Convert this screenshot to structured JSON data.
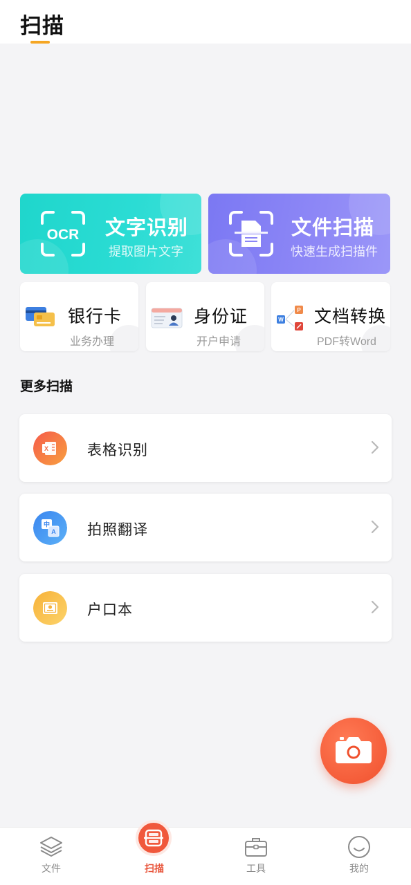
{
  "header": {
    "title": "扫描"
  },
  "big_cards": {
    "ocr": {
      "icon_text": "OCR",
      "title": "文字识别",
      "subtitle": "提取图片文字",
      "color": "#22d8cf"
    },
    "scan": {
      "title": "文件扫描",
      "subtitle": "快速生成扫描件",
      "color": "#8b86f6"
    }
  },
  "small_cards": [
    {
      "title": "银行卡",
      "subtitle": "业务办理",
      "icon": "bank-card-icon"
    },
    {
      "title": "身份证",
      "subtitle": "开户申请",
      "icon": "id-card-icon"
    },
    {
      "title": "文档转换",
      "subtitle": "PDF转Word",
      "icon": "document-convert-icon"
    }
  ],
  "more": {
    "title": "更多扫描",
    "items": [
      {
        "label": "表格识别",
        "icon": "excel-table-icon",
        "color": "#f26a44"
      },
      {
        "label": "拍照翻译",
        "icon": "translate-icon",
        "color": "#3e8ef0"
      },
      {
        "label": "户口本",
        "icon": "household-register-icon",
        "color": "#f8b93a"
      }
    ]
  },
  "fab": {
    "icon": "camera-icon",
    "color": "#f0502d"
  },
  "nav": {
    "items": [
      {
        "label": "文件",
        "icon": "layers-icon"
      },
      {
        "label": "扫描",
        "icon": "scan-icon",
        "active": true
      },
      {
        "label": "工具",
        "icon": "toolbox-icon"
      },
      {
        "label": "我的",
        "icon": "smile-icon"
      }
    ],
    "active_color": "#e8543a"
  }
}
